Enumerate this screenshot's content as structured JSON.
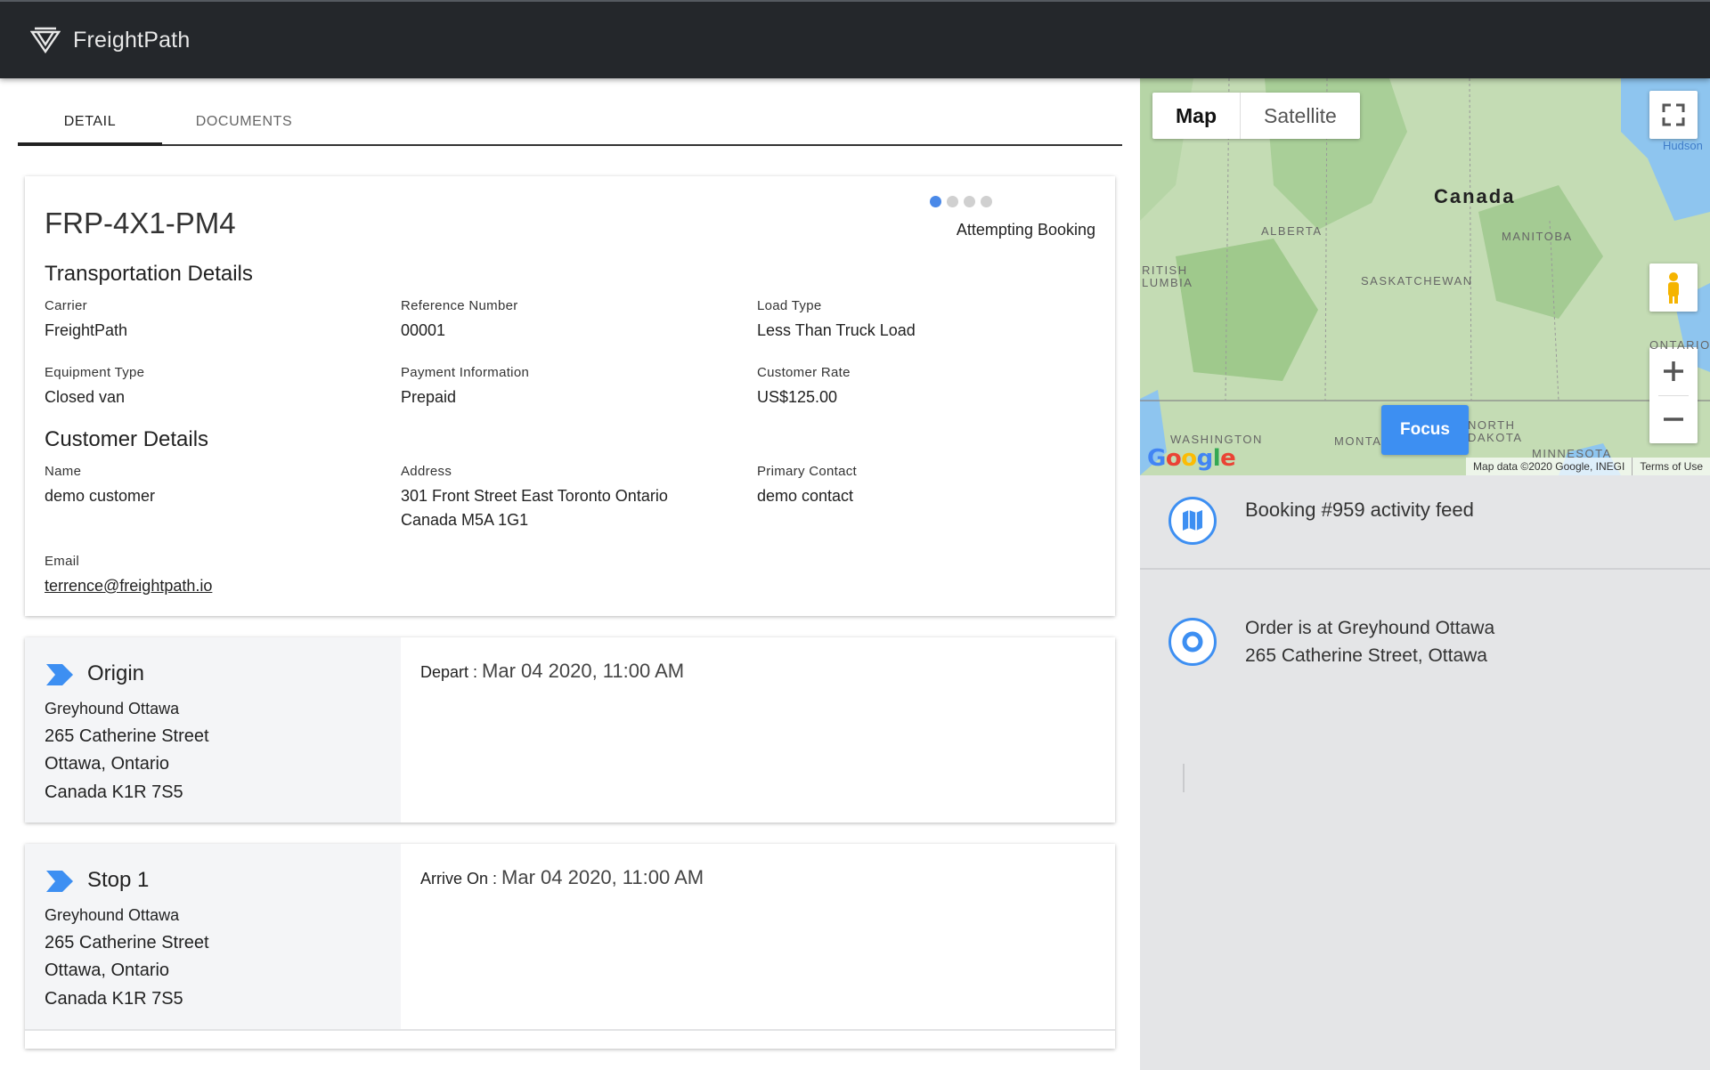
{
  "app": {
    "name": "FreightPath"
  },
  "tabs": [
    {
      "label": "DETAIL"
    },
    {
      "label": "DOCUMENTS"
    }
  ],
  "booking": {
    "id": "FRP-4X1-PM4",
    "status_text": "Attempting Booking",
    "status_steps": 4,
    "status_step_current": 1
  },
  "transportation": {
    "title": "Transportation Details",
    "fields": [
      {
        "label": "Carrier",
        "value": "FreightPath"
      },
      {
        "label": "Reference Number",
        "value": "00001"
      },
      {
        "label": "Load Type",
        "value": "Less Than Truck Load"
      },
      {
        "label": "Equipment Type",
        "value": "Closed van"
      },
      {
        "label": "Payment Information",
        "value": "Prepaid"
      },
      {
        "label": "Customer Rate",
        "value": "US$125.00"
      }
    ]
  },
  "customer": {
    "title": "Customer Details",
    "name_label": "Name",
    "name": "demo customer",
    "address_label": "Address",
    "address_line1": "301 Front Street East Toronto Ontario",
    "address_line2": "Canada M5A 1G1",
    "contact_label": "Primary Contact",
    "contact": "demo contact",
    "email_label": "Email",
    "email": "terrence@freightpath.io"
  },
  "stops": [
    {
      "title": "Origin",
      "place": "Greyhound Ottawa",
      "street": "265 Catherine Street",
      "city": "Ottawa, Ontario",
      "postal": "Canada K1R 7S5",
      "when_label": "Depart :",
      "when_value": "Mar 04 2020, 11:00 AM"
    },
    {
      "title": "Stop 1",
      "place": "Greyhound Ottawa",
      "street": "265 Catherine Street",
      "city": "Ottawa, Ontario",
      "postal": "Canada K1R 7S5",
      "when_label": "Arrive On :",
      "when_value": "Mar 04 2020, 11:00 AM"
    }
  ],
  "map": {
    "type_map": "Map",
    "type_satellite": "Satellite",
    "focus_label": "Focus",
    "labels": {
      "canada": "Canada",
      "alberta": "ALBERTA",
      "manitoba": "MANITOBA",
      "saskatchewan": "SASKATCHEWAN",
      "bc1": "RITISH",
      "bc2": "LUMBIA",
      "ontario": "ONTARIO",
      "washington": "WASHINGTON",
      "montana": "MONTA",
      "nd1": "NORTH",
      "nd2": "DAKOTA",
      "minnesota": "MINNESOTA",
      "hudson": "Hudson"
    },
    "google_logo": "Google",
    "attribution": "Map data ©2020 Google, INEGI",
    "terms": "Terms of Use",
    "colors": {
      "land": "#bfd9b0",
      "water": "#8ec5ef",
      "accent": "#3d8ff2"
    }
  },
  "feed": {
    "title": "Booking #959 activity feed",
    "items": [
      {
        "line1": "Order is at Greyhound Ottawa",
        "line2": "265 Catherine Street, Ottawa"
      }
    ]
  }
}
